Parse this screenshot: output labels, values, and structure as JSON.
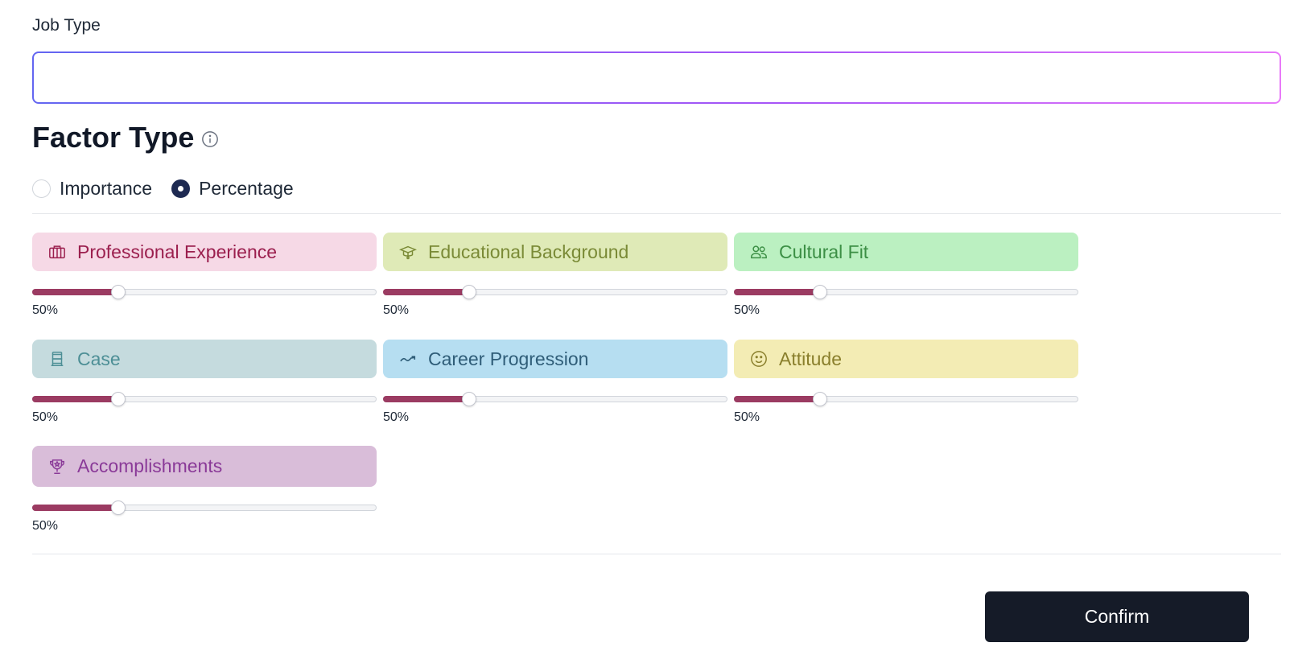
{
  "job_type": {
    "label": "Job Type",
    "value": "",
    "placeholder": ""
  },
  "factor_type": {
    "title": "Factor Type",
    "info_icon": "info-circle-icon",
    "options": [
      {
        "label": "Importance",
        "checked": false
      },
      {
        "label": "Percentage",
        "checked": true
      }
    ]
  },
  "slider_accent": "#9b3b62",
  "factors": [
    {
      "label": "Professional Experience",
      "icon": "briefcase-icon",
      "bg": "#f6d9e6",
      "fg": "#9b1f4e",
      "value": 50,
      "value_label": "50%",
      "fill_fraction": 0.25
    },
    {
      "label": "Educational Background",
      "icon": "graduation-cap-icon",
      "bg": "#dfeab7",
      "fg": "#7a8a36",
      "value": 50,
      "value_label": "50%",
      "fill_fraction": 0.25
    },
    {
      "label": "Cultural Fit",
      "icon": "users-icon",
      "bg": "#bbf0c1",
      "fg": "#3c8f45",
      "value": 50,
      "value_label": "50%",
      "fill_fraction": 0.25
    },
    {
      "label": "Case",
      "icon": "case-stack-icon",
      "bg": "#c5dbde",
      "fg": "#4d8f96",
      "value": 50,
      "value_label": "50%",
      "fill_fraction": 0.25
    },
    {
      "label": "Career Progression",
      "icon": "trending-up-icon",
      "bg": "#b6def1",
      "fg": "#2f5d78",
      "value": 50,
      "value_label": "50%",
      "fill_fraction": 0.25
    },
    {
      "label": "Attitude",
      "icon": "smile-icon",
      "bg": "#f3ecb4",
      "fg": "#8a7f2c",
      "value": 50,
      "value_label": "50%",
      "fill_fraction": 0.25
    },
    {
      "label": "Accomplishments",
      "icon": "trophy-icon",
      "bg": "#d9bdd9",
      "fg": "#8a3a98",
      "value": 50,
      "value_label": "50%",
      "fill_fraction": 0.25
    }
  ],
  "footer": {
    "confirm_label": "Confirm"
  }
}
